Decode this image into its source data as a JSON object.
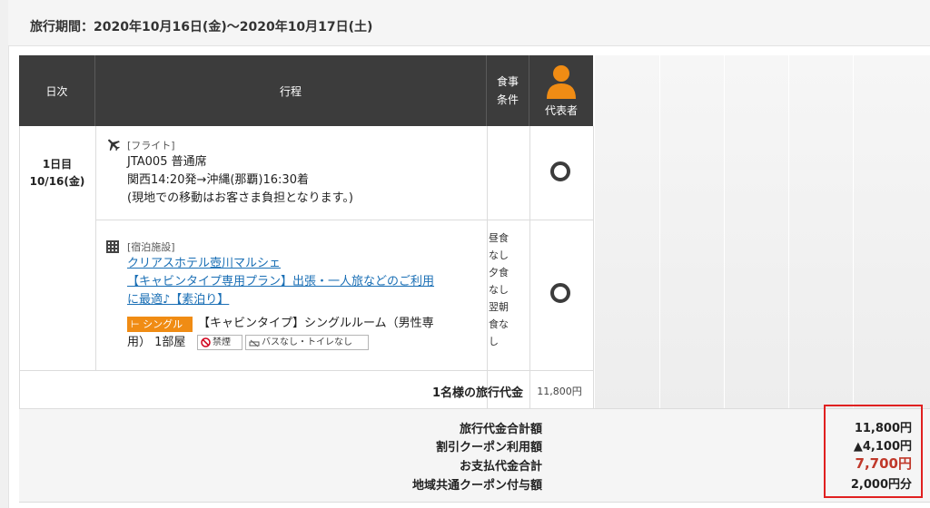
{
  "period": {
    "text": "旅行期間：2020年10月16日(金)〜2020年10月17日(土)"
  },
  "table": {
    "headers": {
      "day": "日次",
      "itinerary": "行程",
      "meal_l1": "食事",
      "meal_l2": "条件",
      "traveler": "代表者"
    },
    "day": {
      "line1": "1日目",
      "line2": "10/16(金)"
    },
    "flight": {
      "tag": "[フライト]",
      "line1": "JTA005 普通席",
      "line2": "関西14:20発→沖縄(那覇)16:30着",
      "line3": "(現地での移動はお客さま負担となります。)",
      "icon": "airplane-icon"
    },
    "hotel": {
      "tag": "[宿泊施設]",
      "name": "クリアスホテル壺川マルシェ",
      "plan_l1": "【キャビンタイプ専用プラン】出張・一人旅などのご利用",
      "plan_l2": "に最適♪【素泊り】",
      "badge": "シングル",
      "room_l1": "【キャビンタイプ】シングルルーム（男性専",
      "room_l2": "用） 1部屋",
      "chip_smoke": "禁煙",
      "chip_bath": "バスなし・トイレなし",
      "icon": "building-icon"
    },
    "meals": [
      "昼食",
      "なし",
      "夕食",
      "なし",
      "翌朝",
      "食な",
      "し"
    ],
    "pax_total_label": "1名様の旅行代金",
    "pax_total_value": "11,800円"
  },
  "summary": {
    "labels": [
      "旅行代金合計額",
      "割引クーポン利用額",
      "お支払代金合計",
      "地域共通クーポン付与額"
    ],
    "values": [
      "11,800円",
      "▲4,100円",
      "7,700円",
      "2,000円分"
    ]
  },
  "colors": {
    "header_bg": "#3c3c3c",
    "accent_orange": "#f08c14",
    "link": "#1a6fb5",
    "highlight_red": "#e02020",
    "paid_red": "#c0392b"
  }
}
